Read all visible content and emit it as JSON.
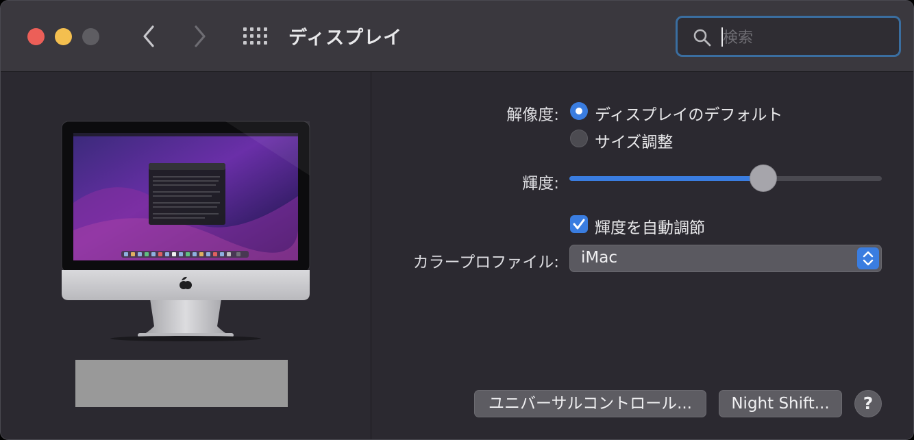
{
  "window": {
    "title": "ディスプレイ"
  },
  "search": {
    "placeholder": "検索",
    "value": ""
  },
  "toolbar": {
    "back_icon": "chevron-left-icon",
    "forward_icon": "chevron-right-icon",
    "grid_icon": "grid-icon"
  },
  "settings": {
    "resolution_label": "解像度:",
    "resolution_options": [
      {
        "label": "ディスプレイのデフォルト",
        "selected": true
      },
      {
        "label": "サイズ調整",
        "selected": false
      }
    ],
    "brightness_label": "輝度:",
    "brightness_value": 0.62,
    "auto_brightness_label": "輝度を自動調節",
    "auto_brightness_checked": true,
    "color_profile_label": "カラープロファイル:",
    "color_profile_value": "iMac"
  },
  "buttons": {
    "universal_control": "ユニバーサルコントロール...",
    "night_shift": "Night Shift...",
    "help": "?"
  },
  "colors": {
    "accent": "#3a7de0",
    "window_bg": "#2b2930",
    "titlebar_bg": "#3a383e"
  }
}
